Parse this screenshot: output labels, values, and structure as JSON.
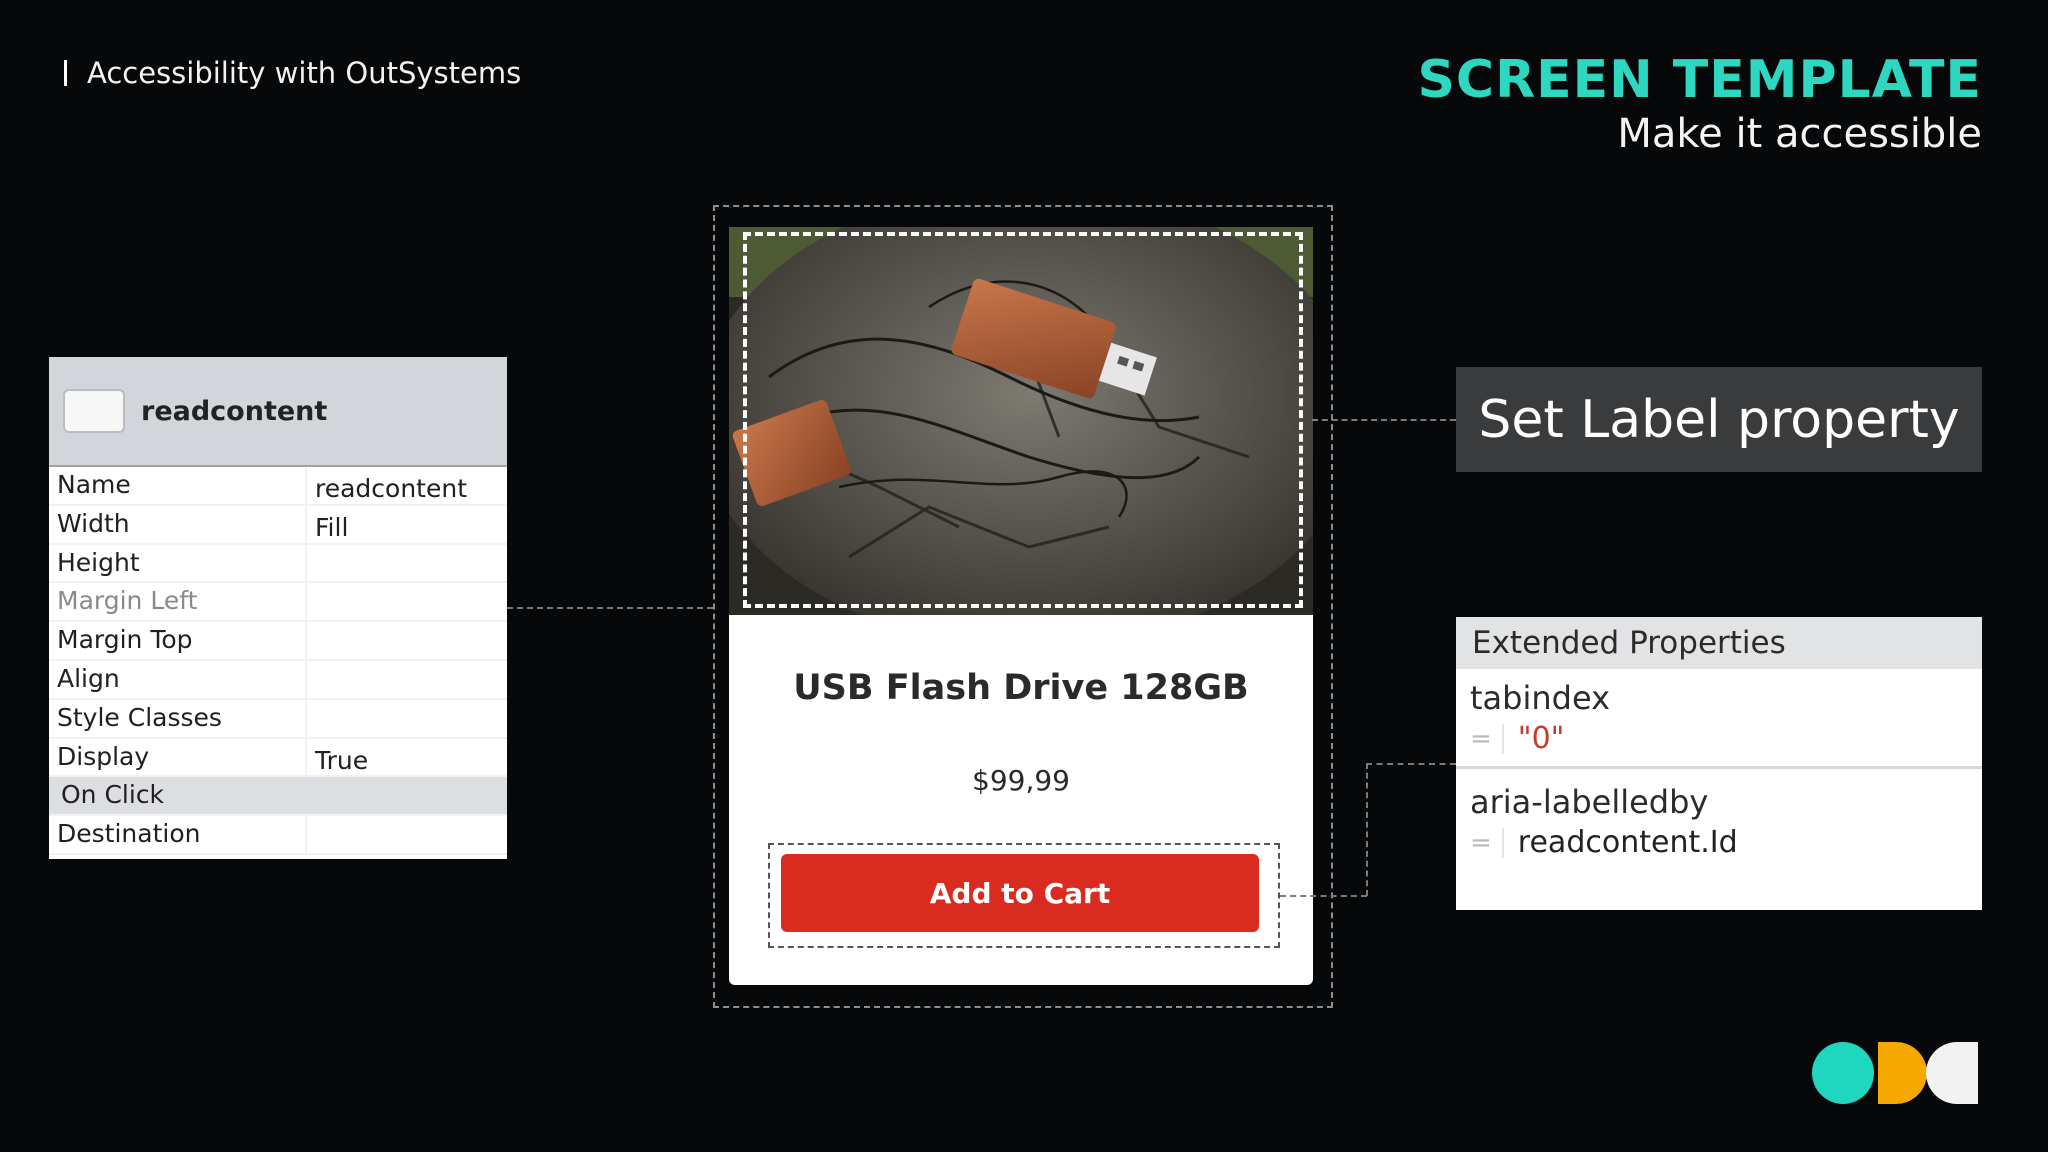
{
  "header": {
    "course_title": "Accessibility with OutSystems",
    "section_title": "SCREEN TEMPLATE",
    "section_subtitle": "Make it accessible"
  },
  "properties_panel": {
    "widget_name": "readcontent",
    "rows": [
      {
        "key": "Name",
        "value": "readcontent"
      },
      {
        "key": "Width",
        "value": "Fill"
      },
      {
        "key": "Height",
        "value": ""
      },
      {
        "key": "Margin Left",
        "value": ""
      },
      {
        "key": "Margin Top",
        "value": ""
      },
      {
        "key": "Align",
        "value": ""
      },
      {
        "key": "Style Classes",
        "value": ""
      },
      {
        "key": "Display",
        "value": "True"
      },
      {
        "key": "On Click",
        "value": ""
      },
      {
        "key": "Destination",
        "value": ""
      }
    ]
  },
  "product_card": {
    "image_description": "usb-flash-drive-photo",
    "title": "USB Flash Drive 128GB",
    "price": "$99,99",
    "button_label": "Add to Cart"
  },
  "callout": {
    "text": "Set Label property"
  },
  "extended_properties": {
    "header": "Extended Properties",
    "items": [
      {
        "name": "tabindex",
        "eq": "=",
        "value": "\"0\""
      },
      {
        "name": "aria-labelledby",
        "eq": "=",
        "value": "readcontent.Id"
      }
    ]
  },
  "colors": {
    "accent": "#2ed8c0",
    "button": "#d92b1f",
    "logo_teal": "#1fd6bf",
    "logo_orange": "#f5a800",
    "logo_white": "#f2f2f2"
  }
}
